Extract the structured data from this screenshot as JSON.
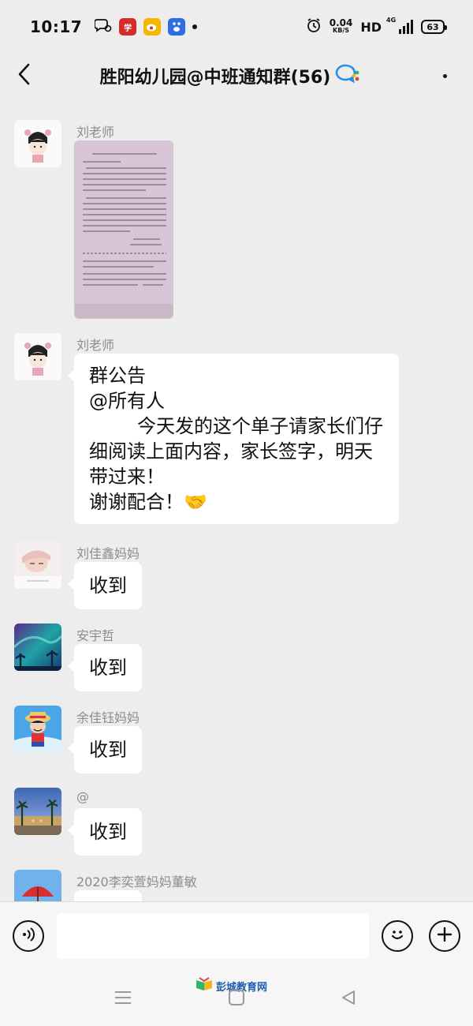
{
  "status_bar": {
    "time": "10:17",
    "net_speed_value": "0.04",
    "net_speed_unit": "KB/S",
    "hd_label": "HD",
    "network_label": "4G",
    "battery": "63",
    "app_icons": [
      "chat-bubbles-icon",
      "xuexi-app-icon",
      "weibo-icon",
      "baidu-icon"
    ]
  },
  "header": {
    "title": "胜阳幼儿园@中班通知群(56)",
    "work_group_icon": "wecom-icon",
    "back_icon": "back-arrow-icon",
    "more_icon": "more-dots-icon"
  },
  "messages": [
    {
      "sender": "刘老师",
      "type": "image",
      "avatar": "cartoon-girl-avatar"
    },
    {
      "sender": "刘老师",
      "type": "text",
      "avatar": "cartoon-girl-avatar",
      "text": "群公告\n@所有人\n        今天发的这个单子请家长们仔细阅读上面内容，家长签字，明天带过来！\n谢谢配合！🤝"
    },
    {
      "sender": "刘佳鑫妈妈",
      "type": "text",
      "avatar": "baby-photo-avatar",
      "text": "收到"
    },
    {
      "sender": "安宇哲",
      "type": "text",
      "avatar": "aurora-trees-avatar",
      "text": "收到"
    },
    {
      "sender": "余佳钰妈妈",
      "type": "text",
      "avatar": "cartoon-boy-avatar",
      "text": "收到"
    },
    {
      "sender": "@",
      "type": "text",
      "avatar": "palm-street-avatar",
      "text": "收到"
    },
    {
      "sender": "2020李奕萱妈妈董敏",
      "type": "text",
      "avatar": "red-umbrella-avatar",
      "text": ""
    }
  ],
  "input_bar": {
    "voice_icon": "voice-input-icon",
    "placeholder": "",
    "emoji_icon": "emoji-icon",
    "plus_icon": "plus-icon"
  },
  "system_nav": {
    "menu_icon": "menu-icon",
    "home_icon": "home-icon",
    "back_icon": "back-triangle-icon",
    "watermark": "彭城教育网"
  },
  "colors": {
    "background": "#ededed",
    "bubble": "#ffffff",
    "sender_text": "#8c8c8c",
    "watermark": "#1f5fb0"
  }
}
